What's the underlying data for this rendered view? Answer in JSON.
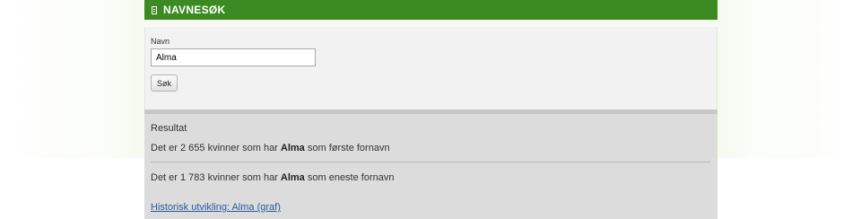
{
  "header": {
    "title": "NAVNESØK",
    "icon": "document-icon"
  },
  "form": {
    "name_label": "Navn",
    "name_value": "Alma",
    "search_button": "Søk"
  },
  "results": {
    "heading": "Resultat",
    "line1": {
      "prefix": "Det er 2 655 kvinner som har ",
      "name": "Alma",
      "suffix": " som første fornavn"
    },
    "line2": {
      "prefix": "Det er 1 783 kvinner som har ",
      "name": "Alma",
      "suffix": " som eneste fornavn"
    },
    "history_link": "Historisk utvikling: Alma (graf)"
  },
  "colors": {
    "header_bg": "#3b8a22",
    "form_bg": "#f2f2f2",
    "results_bg": "#dcdcdc",
    "link": "#2a5a9a"
  }
}
